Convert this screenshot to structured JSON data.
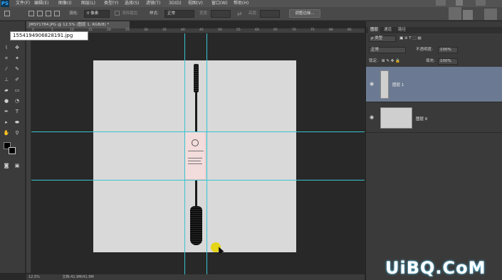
{
  "app": {
    "logo": "PS"
  },
  "menu": [
    "文件(F)",
    "编辑(E)",
    "图像(I)",
    "图层(L)",
    "类型(Y)",
    "选择(S)",
    "滤镜(T)",
    "3D(D)",
    "视图(V)",
    "窗口(W)",
    "帮助(H)"
  ],
  "options": {
    "feather_label": "羽化:",
    "feather_value": "0 像素",
    "antialias_label": "消除锯齿",
    "style_label": "样式:",
    "style_value": "正常",
    "width_label": "宽度:",
    "height_label": "高度:",
    "refine_button": "调整边缘..."
  },
  "document": {
    "tab_title": "JMSY1784.JPG @ 12.5% (图层 1, RGB/8) *",
    "tooltip_filename": "1554194906828191.jpg"
  },
  "ruler": {
    "top_ticks": [
      "0",
      "5",
      "10",
      "15",
      "20",
      "25",
      "30",
      "35",
      "40",
      "45",
      "50",
      "55",
      "60",
      "65",
      "70",
      "75",
      "80",
      "85"
    ]
  },
  "status": {
    "zoom": "12.5%",
    "info": "文档:41.9M/41.9M"
  },
  "layers_panel": {
    "tabs": [
      "图层",
      "通道",
      "路径"
    ],
    "filter_label": "ρ 类型",
    "blend_mode": "正常",
    "opacity_label": "不透明度:",
    "opacity_value": "100%",
    "lock_label": "锁定:",
    "fill_label": "填充:",
    "fill_value": "100%",
    "layers": [
      {
        "name": "图层 1",
        "selected": true
      },
      {
        "name": "图层 0",
        "selected": false
      }
    ]
  },
  "watermark": "UiBQ.CoM",
  "colors": {
    "guide": "#36c4d1",
    "selected_layer": "#6b7a92",
    "cursor": "#e6d400"
  }
}
